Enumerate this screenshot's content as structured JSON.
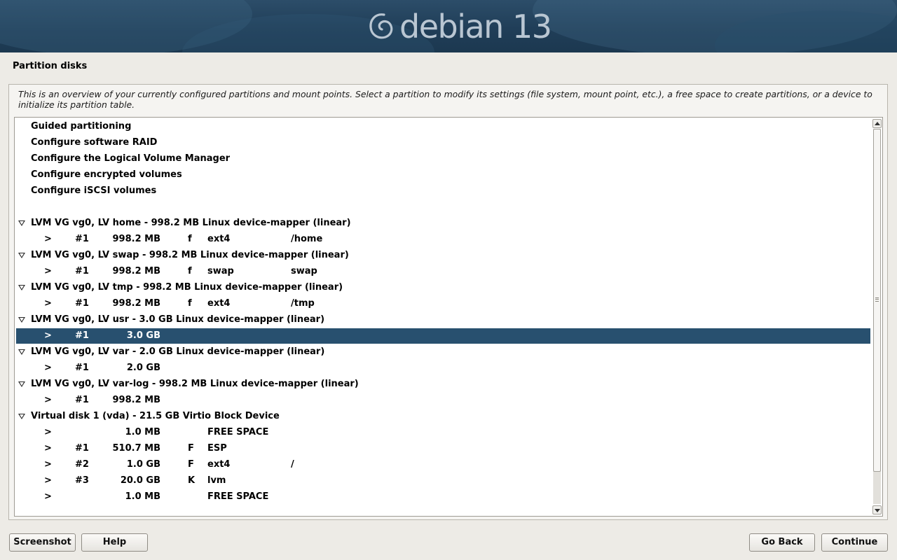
{
  "brand": {
    "logo_text": "debian 13"
  },
  "page": {
    "title": "Partition disks"
  },
  "intro_text": "This is an overview of your currently configured partitions and mount points. Select a partition to modify its settings (file system, mount point, etc.), a free space to create partitions, or a device to initialize its partition table.",
  "menu": [
    "Guided partitioning",
    "Configure software RAID",
    "Configure the Logical Volume Manager",
    "Configure encrypted volumes",
    "Configure iSCSI volumes"
  ],
  "devices": [
    {
      "label": "LVM VG vg0, LV home - 998.2 MB Linux device-mapper (linear)",
      "partitions": [
        {
          "arrow": ">",
          "num": "#1",
          "size": "998.2 MB",
          "flag": "f",
          "fs": "ext4",
          "mount": "/home"
        }
      ]
    },
    {
      "label": "LVM VG vg0, LV swap - 998.2 MB Linux device-mapper (linear)",
      "partitions": [
        {
          "arrow": ">",
          "num": "#1",
          "size": "998.2 MB",
          "flag": "f",
          "fs": "swap",
          "mount": "swap"
        }
      ]
    },
    {
      "label": "LVM VG vg0, LV tmp - 998.2 MB Linux device-mapper (linear)",
      "partitions": [
        {
          "arrow": ">",
          "num": "#1",
          "size": "998.2 MB",
          "flag": "f",
          "fs": "ext4",
          "mount": "/tmp"
        }
      ]
    },
    {
      "label": "LVM VG vg0, LV usr - 3.0 GB Linux device-mapper (linear)",
      "partitions": [
        {
          "arrow": ">",
          "num": "#1",
          "size": "3.0 GB",
          "flag": "",
          "fs": "",
          "mount": "",
          "selected": true
        }
      ]
    },
    {
      "label": "LVM VG vg0, LV var - 2.0 GB Linux device-mapper (linear)",
      "partitions": [
        {
          "arrow": ">",
          "num": "#1",
          "size": "2.0 GB",
          "flag": "",
          "fs": "",
          "mount": ""
        }
      ]
    },
    {
      "label": "LVM VG vg0, LV var-log - 998.2 MB Linux device-mapper (linear)",
      "partitions": [
        {
          "arrow": ">",
          "num": "#1",
          "size": "998.2 MB",
          "flag": "",
          "fs": "",
          "mount": ""
        }
      ]
    },
    {
      "label": "Virtual disk 1 (vda) - 21.5 GB Virtio Block Device",
      "partitions": [
        {
          "arrow": ">",
          "num": "",
          "size": "1.0 MB",
          "flag": "",
          "fs": "FREE SPACE",
          "mount": ""
        },
        {
          "arrow": ">",
          "num": "#1",
          "size": "510.7 MB",
          "flag": "F",
          "fs": "ESP",
          "mount": ""
        },
        {
          "arrow": ">",
          "num": "#2",
          "size": "1.0 GB",
          "flag": "F",
          "fs": "ext4",
          "mount": "/"
        },
        {
          "arrow": ">",
          "num": "#3",
          "size": "20.0 GB",
          "flag": "K",
          "fs": "lvm",
          "mount": ""
        },
        {
          "arrow": ">",
          "num": "",
          "size": "1.0 MB",
          "flag": "",
          "fs": "FREE SPACE",
          "mount": ""
        }
      ]
    }
  ],
  "buttons": {
    "screenshot": "Screenshot",
    "help": "Help",
    "back": "Go Back",
    "continue": "Continue"
  },
  "colors": {
    "banner": "#203e58",
    "selection": "#28506f",
    "background": "#edebe6"
  },
  "icons": [
    "debian-swirl-icon",
    "expand-triangle-icon",
    "scroll-up-icon",
    "scroll-down-icon"
  ]
}
